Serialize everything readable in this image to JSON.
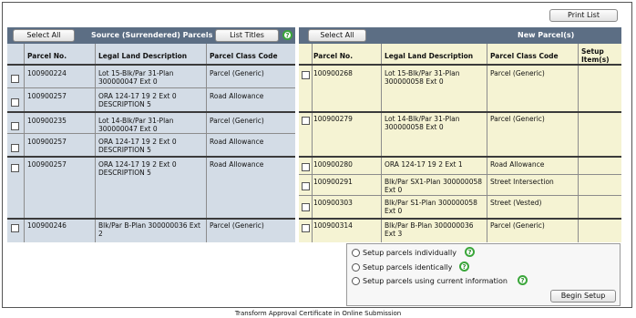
{
  "top": {
    "print_list": "Print List"
  },
  "left": {
    "select_all": "Select All",
    "title": "Source (Surrendered) Parcels",
    "list_titles": "List Titles",
    "help": "?",
    "headers": {
      "parcel": "Parcel No.",
      "legal": "Legal Land Description",
      "class": "Parcel Class Code"
    },
    "rows": [
      {
        "parcel": "100900224",
        "legal": "Lot 15-Blk/Par 31-Plan 300000047 Ext 0",
        "class": "Parcel (Generic)"
      },
      {
        "parcel": "100900257",
        "legal": "ORA 124-17 19 2 Ext 0 DESCRIPTION 5",
        "class": "Road Allowance"
      },
      {
        "parcel": "100900235",
        "legal": "Lot 14-Blk/Par 31-Plan 300000047 Ext 0",
        "class": "Parcel (Generic)"
      },
      {
        "parcel": "100900257",
        "legal": "ORA 124-17 19 2 Ext 0 DESCRIPTION 5",
        "class": "Road Allowance"
      },
      {
        "parcel": "100900257",
        "legal": "ORA 124-17 19 2 Ext 0 DESCRIPTION 5",
        "class": "Road Allowance"
      },
      {
        "parcel": "100900246",
        "legal": "Blk/Par B-Plan 300000036 Ext 2",
        "class": "Parcel (Generic)"
      }
    ]
  },
  "right": {
    "select_all": "Select All",
    "title": "New Parcel(s)",
    "headers": {
      "parcel": "Parcel No.",
      "legal": "Legal Land Description",
      "class": "Parcel Class Code",
      "setup": "Setup Item(s)"
    },
    "rows": [
      {
        "parcel": "100900268",
        "legal": "Lot 15-Blk/Par 31-Plan 300000058 Ext 0",
        "class": "Parcel (Generic)"
      },
      {
        "parcel": "100900279",
        "legal": "Lot 14-Blk/Par 31-Plan 300000058 Ext 0",
        "class": "Parcel (Generic)"
      },
      {
        "parcel": "100900280",
        "legal": "ORA 124-17 19 2 Ext 1",
        "class": "Road Allowance"
      },
      {
        "parcel": "100900291",
        "legal": "Blk/Par SX1-Plan 300000058 Ext 0",
        "class": "Street Intersection"
      },
      {
        "parcel": "100900303",
        "legal": "Blk/Par S1-Plan 300000058 Ext 0",
        "class": "Street (Vested)"
      },
      {
        "parcel": "100900314",
        "legal": "Blk/Par B-Plan 300000036 Ext 3",
        "class": "Parcel (Generic)"
      }
    ]
  },
  "setup": {
    "opt1": "Setup parcels individually",
    "opt2": "Setup parcels identically",
    "opt3": "Setup parcels using current information",
    "help": "?",
    "begin": "Begin Setup"
  },
  "caption": "Transform Approval Certificate in Online Submission"
}
